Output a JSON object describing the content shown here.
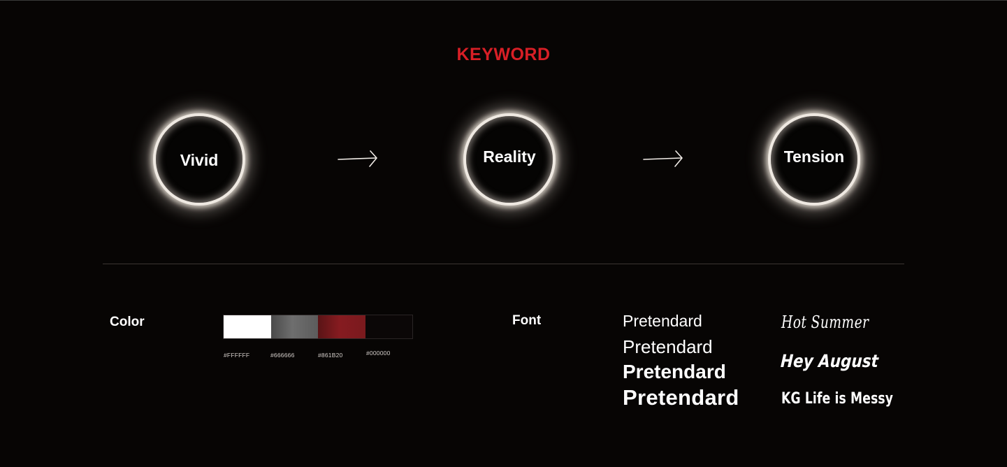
{
  "header": {
    "title": "KEYWORD",
    "accent": "#d81f26"
  },
  "keywords": [
    "Vivid",
    "Reality",
    "Tension"
  ],
  "color": {
    "label": "Color",
    "swatches": [
      {
        "hex": "#FFFFFF",
        "fill": "#ffffff"
      },
      {
        "hex": "#666666",
        "fill": "#666666"
      },
      {
        "hex": "#861B20",
        "fill": "#861b20"
      },
      {
        "hex": "#000000",
        "fill": "#0b0707"
      }
    ]
  },
  "font": {
    "label": "Font",
    "samples": [
      "Pretendard",
      "Pretendard",
      "Pretendard",
      "Pretendard"
    ],
    "display_samples": [
      "Hot Summer",
      "Hey August",
      "KG Life is Messy"
    ]
  }
}
